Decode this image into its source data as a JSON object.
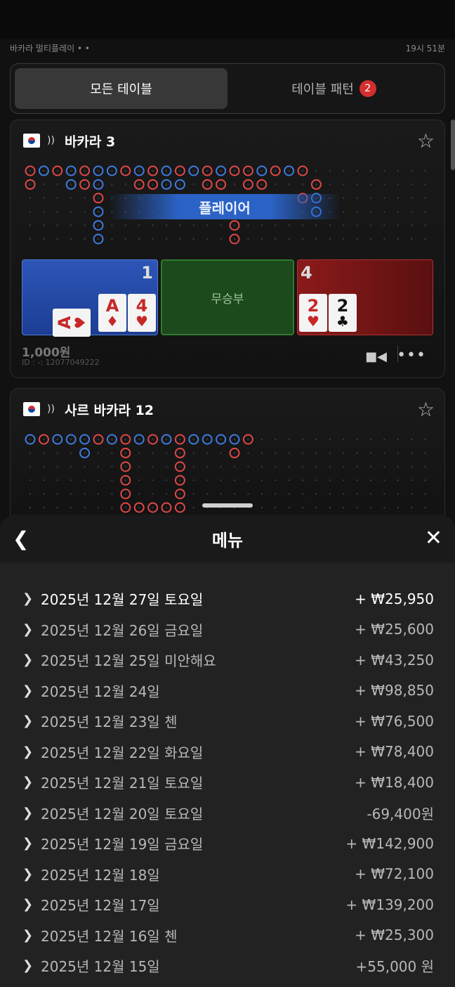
{
  "header": {
    "title": "바카라 멀티플레이 • •",
    "time": "19시 51분"
  },
  "tabs": [
    {
      "label": "모든 테이블",
      "active": true
    },
    {
      "label": "테이블 패턴",
      "badge": "2",
      "active": false
    }
  ],
  "tables": [
    {
      "name": "바카라 3",
      "banner": "플레이어",
      "player_score": "1",
      "tie_label": "무승부",
      "banker_score": "4",
      "player_cards": [
        {
          "rank": "A",
          "suit": "♥"
        },
        {
          "rank": "A",
          "suit": "♦"
        },
        {
          "rank": "4",
          "suit": "♥"
        }
      ],
      "banker_cards": [
        {
          "rank": "2",
          "suit": "♥"
        },
        {
          "rank": "2",
          "suit": "♣"
        }
      ],
      "min_bet": "1,000원",
      "id": "ID : -: 12077049222"
    },
    {
      "name": "사르 바카라 12"
    }
  ],
  "menu": {
    "title": "메뉴",
    "back_icon": "chevron-left-icon",
    "close_icon": "close-icon",
    "items": [
      {
        "date": "2025년 12월 27일 토요일",
        "amount": "+ ₩25,950"
      },
      {
        "date": "2025년 12월 26일 금요일",
        "amount": "+ ₩25,600"
      },
      {
        "date": "2025년 12월 25일 미안해요",
        "amount": "+ ₩43,250"
      },
      {
        "date": "2025년 12월 24일",
        "amount": "+ ₩98,850"
      },
      {
        "date": "2025년 12월 23일 첸",
        "amount": "+ ₩76,500"
      },
      {
        "date": "2025년 12월 22일 화요일",
        "amount": "+ ₩78,400"
      },
      {
        "date": "2025년 12월 21일 토요일",
        "amount": "+ ₩18,400"
      },
      {
        "date": "2025년 12월 20일 토요일",
        "amount": "-69,400원"
      },
      {
        "date": "2025년 12월 19일 금요일",
        "amount": "+ ₩142,900"
      },
      {
        "date": "2025년 12월 18일",
        "amount": "+ ₩72,100"
      },
      {
        "date": "2025년 12월 17일",
        "amount": "+ ₩139,200"
      },
      {
        "date": "2025년 12월 16일 첸",
        "amount": "+ ₩25,300"
      },
      {
        "date": "2025년 12월 15일",
        "amount": "+55,000 원"
      }
    ]
  },
  "colors": {
    "player": "#2d56b8",
    "banker": "#8c1a1a",
    "tie": "#1d4a1d",
    "badge": "#d32f2f",
    "road_red": "#e04848",
    "road_blue": "#3d7be0"
  }
}
